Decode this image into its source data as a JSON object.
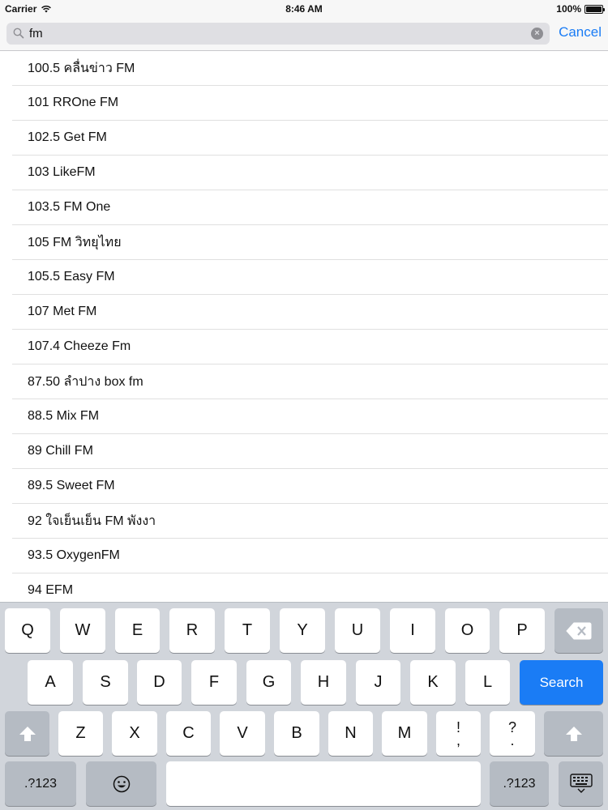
{
  "status_bar": {
    "carrier": "Carrier",
    "time": "8:46 AM",
    "battery": "100%",
    "battery_level": 1.0
  },
  "search": {
    "value": "fm",
    "placeholder": "",
    "cancel_label": "Cancel"
  },
  "results": [
    "100.5 คลื่นข่าว FM",
    "101 RROne FM",
    "102.5 Get FM",
    "103 LikeFM",
    "103.5 FM One",
    "105 FM วิทยุไทย",
    "105.5 Easy FM",
    "107 Met FM",
    "107.4 Cheeze Fm",
    "87.50 ลำปาง box fm",
    "88.5 Mix FM",
    "89 Chill FM",
    "89.5 Sweet FM",
    "92 ใจเย็นเย็น FM พังงา",
    "93.5 OxygenFM",
    "94 EFM"
  ],
  "keyboard": {
    "row1": [
      "Q",
      "W",
      "E",
      "R",
      "T",
      "Y",
      "U",
      "I",
      "O",
      "P"
    ],
    "row2": [
      "A",
      "S",
      "D",
      "F",
      "G",
      "H",
      "J",
      "K",
      "L"
    ],
    "row3": [
      "Z",
      "X",
      "C",
      "V",
      "B",
      "N",
      "M"
    ],
    "punct1": [
      "!",
      ","
    ],
    "punct2": [
      "?",
      "."
    ],
    "search_label": "Search",
    "numbers_label": ".?123"
  }
}
